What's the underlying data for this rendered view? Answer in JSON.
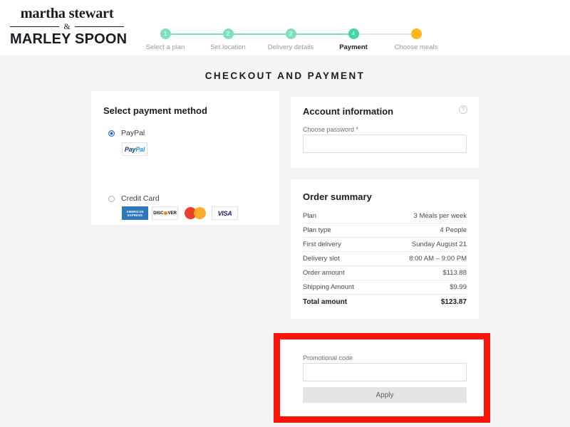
{
  "brand": {
    "line1": "martha stewart",
    "ampersand": "&",
    "line2": "MARLEY SPOON"
  },
  "stepper": {
    "steps": [
      {
        "number": "1",
        "label": "Select a plan",
        "state": "done"
      },
      {
        "number": "2",
        "label": "Set location",
        "state": "done"
      },
      {
        "number": "3",
        "label": "Delivery details",
        "state": "done"
      },
      {
        "number": "4",
        "label": "Payment",
        "state": "active"
      },
      {
        "number": "",
        "label": "Choose meals",
        "state": "pending"
      }
    ],
    "colors": {
      "done": "#7fe0bd",
      "active": "#3fd6a5",
      "pending": "#ffb81c",
      "line_inactive": "#e3e3e3"
    }
  },
  "page_title": "CHECKOUT AND PAYMENT",
  "payment_method": {
    "title": "Select payment method",
    "options": [
      {
        "label": "PayPal",
        "selected": true
      },
      {
        "label": "Credit Card",
        "selected": false
      }
    ],
    "paypal_badge": {
      "part1": "Pay",
      "part2": "Pal"
    },
    "card_badges": [
      {
        "name": "american-express",
        "line1": "AMERICAN",
        "line2": "EXPRESS"
      },
      {
        "name": "discover",
        "pre": "DISC",
        "post": "VER"
      },
      {
        "name": "mastercard",
        "text": ""
      },
      {
        "name": "visa",
        "text": "VISA"
      }
    ]
  },
  "account": {
    "title": "Account information",
    "help_icon": "?",
    "password_label": "Choose password *",
    "password_value": "",
    "password_placeholder": ""
  },
  "order_summary": {
    "title": "Order summary",
    "rows": [
      {
        "label": "Plan",
        "value": "3 Meals per week"
      },
      {
        "label": "Plan type",
        "value": "4 People"
      },
      {
        "label": "First delivery",
        "value": "Sunday August 21"
      },
      {
        "label": "Delivery slot",
        "value": "8:00 AM – 9:00 PM"
      },
      {
        "label": "Order amount",
        "value": "$113.88"
      },
      {
        "label": "Shipping Amount",
        "value": "$9.99"
      },
      {
        "label": "Total amount",
        "value": "$123.87"
      }
    ]
  },
  "promo": {
    "label": "Promotional code",
    "value": "",
    "placeholder": "",
    "apply_label": "Apply"
  },
  "annotation": {
    "color": "#fb1409"
  }
}
